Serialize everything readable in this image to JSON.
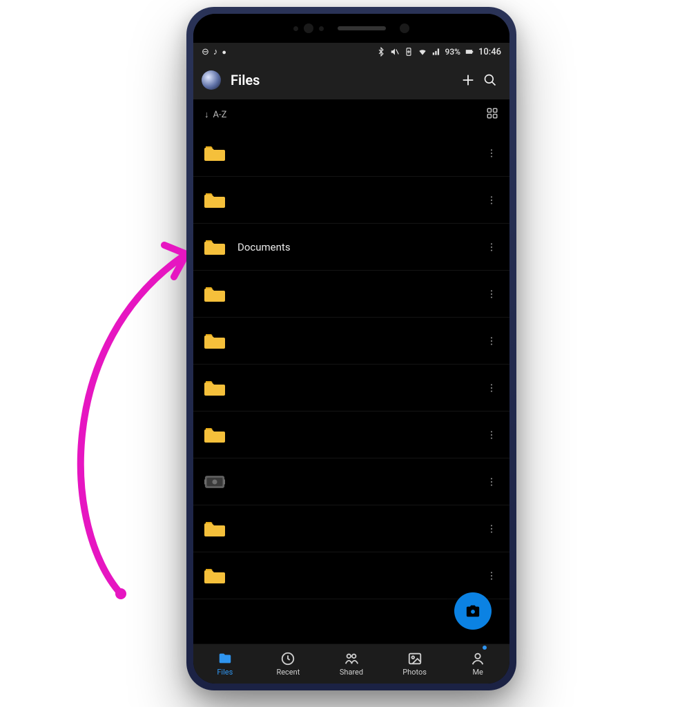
{
  "status": {
    "notif1": "⊖",
    "notif2": "♪",
    "notif3": "◉",
    "bt": "bluetooth",
    "mute": "mute",
    "batt_save": "battsave",
    "wifi": "wifi",
    "signal": "signal",
    "battery_pct": "93%",
    "battery_icon": "battery",
    "time": "10:46"
  },
  "header": {
    "title": "Files",
    "add": "+",
    "search": "search"
  },
  "sort": {
    "arrow": "↓",
    "label": "A-Z",
    "view_toggle": "grid"
  },
  "files": [
    {
      "type": "folder",
      "name": ""
    },
    {
      "type": "folder",
      "name": ""
    },
    {
      "type": "folder",
      "name": "Documents"
    },
    {
      "type": "folder",
      "name": ""
    },
    {
      "type": "folder",
      "name": ""
    },
    {
      "type": "folder",
      "name": ""
    },
    {
      "type": "folder",
      "name": ""
    },
    {
      "type": "vault",
      "name": ""
    },
    {
      "type": "folder",
      "name": ""
    },
    {
      "type": "folder",
      "name": ""
    }
  ],
  "fab": {
    "action": "camera"
  },
  "nav": {
    "items": [
      {
        "key": "files",
        "label": "Files",
        "active": true
      },
      {
        "key": "recent",
        "label": "Recent",
        "active": false
      },
      {
        "key": "shared",
        "label": "Shared",
        "active": false
      },
      {
        "key": "photos",
        "label": "Photos",
        "active": false
      },
      {
        "key": "me",
        "label": "Me",
        "active": false,
        "badge": true
      }
    ]
  },
  "annotation": {
    "arrow_color": "#e616c1"
  }
}
